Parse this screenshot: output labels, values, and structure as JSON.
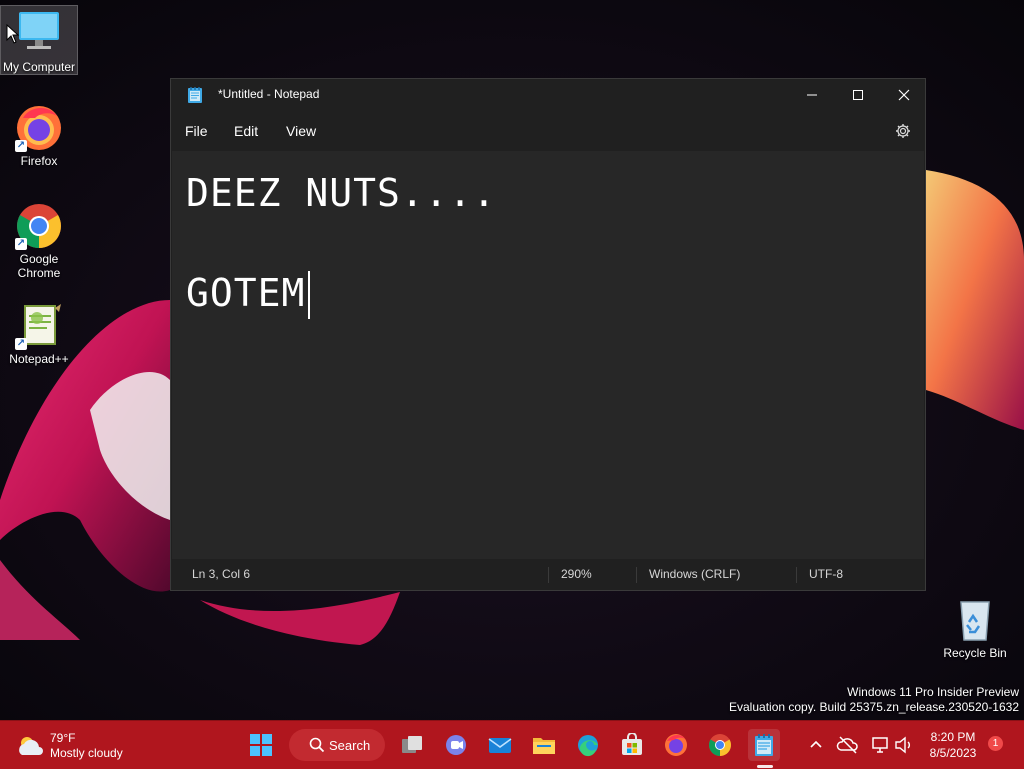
{
  "desktop": {
    "icons": [
      {
        "label": "My Computer",
        "icon": "monitor-icon"
      },
      {
        "label": "Firefox",
        "icon": "firefox-icon"
      },
      {
        "label": "Google Chrome",
        "icon": "chrome-icon"
      },
      {
        "label": "Notepad++",
        "icon": "notepadpp-icon"
      },
      {
        "label": "Recycle Bin",
        "icon": "recycle-bin-icon"
      }
    ],
    "watermark": {
      "line1": "Windows 11 Pro Insider Preview",
      "line2": "Evaluation copy. Build 25375.zn_release.230520-1632"
    }
  },
  "notepad": {
    "title": "*Untitled - Notepad",
    "menu": [
      "File",
      "Edit",
      "View"
    ],
    "content": {
      "line1": "DEEZ NUTS....",
      "line2": "",
      "line3": "GOTEM"
    },
    "status": {
      "position": "Ln 3, Col 6",
      "zoom": "290%",
      "line_ending": "Windows (CRLF)",
      "encoding": "UTF-8"
    }
  },
  "taskbar": {
    "weather": {
      "temp": "79°F",
      "condition": "Mostly cloudy"
    },
    "search_label": "Search",
    "apps": [
      "start-icon",
      "search",
      "task-view-icon",
      "teams-chat-icon",
      "mail-icon",
      "file-explorer-icon",
      "edge-icon",
      "store-icon",
      "firefox-icon",
      "chrome-icon",
      "notepad-icon"
    ],
    "clock": {
      "time": "8:20 PM",
      "date": "8/5/2023"
    },
    "notification_count": "1"
  },
  "colors": {
    "taskbar": "#b0161e",
    "notepad_bg": "#272727",
    "titlebar_bg": "#202020"
  }
}
